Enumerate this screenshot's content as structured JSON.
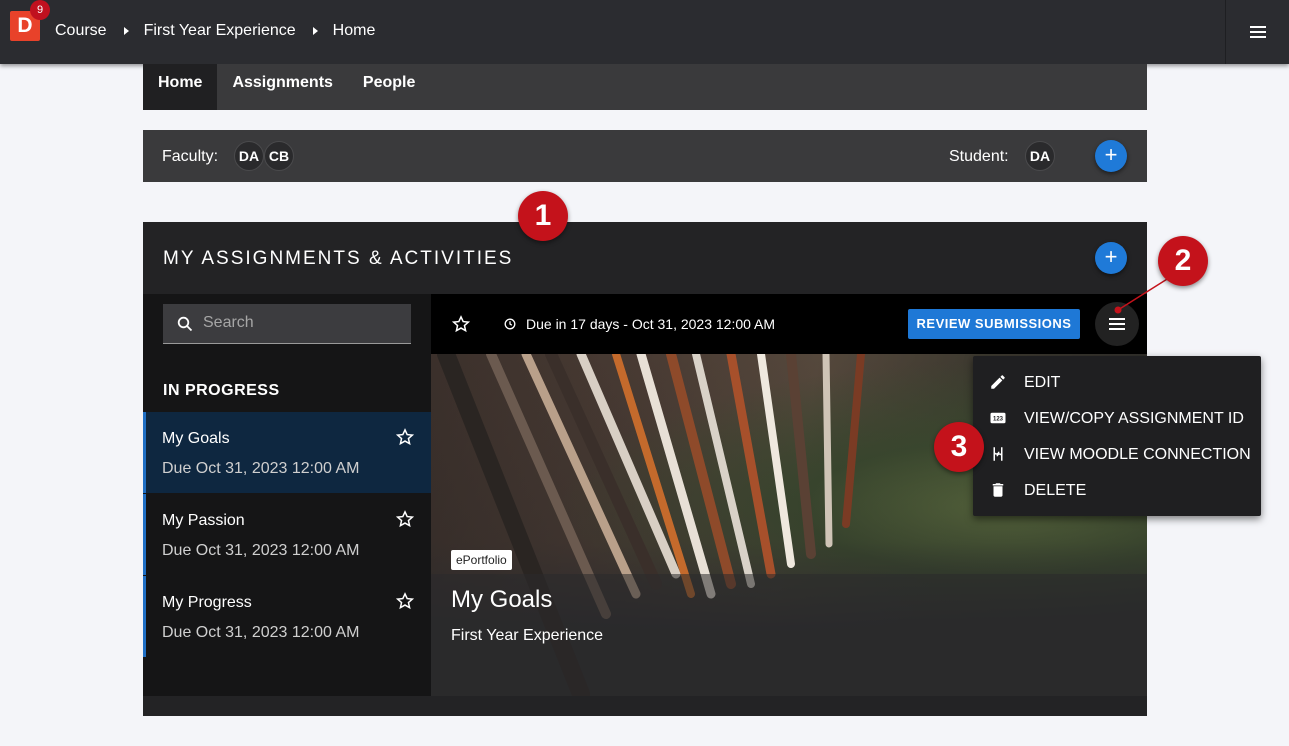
{
  "app": {
    "logo_letter": "D",
    "notification_count": "9"
  },
  "breadcrumbs": [
    "Course",
    "First Year Experience",
    "Home"
  ],
  "tabs": [
    {
      "label": "Home",
      "active": true
    },
    {
      "label": "Assignments",
      "active": false
    },
    {
      "label": "People",
      "active": false
    }
  ],
  "members": {
    "faculty_label": "Faculty:",
    "faculty": [
      "DA",
      "CB"
    ],
    "student_label": "Student:",
    "students": [
      "DA"
    ],
    "add_button": "+"
  },
  "assignments": {
    "title": "MY ASSIGNMENTS & ACTIVITIES",
    "add_button": "+",
    "search_placeholder": "Search",
    "section_label": "IN PROGRESS",
    "items": [
      {
        "title": "My Goals",
        "due": "Due Oct 31, 2023 12:00 AM",
        "selected": true
      },
      {
        "title": "My Passion",
        "due": "Due Oct 31, 2023 12:00 AM",
        "selected": false
      },
      {
        "title": "My Progress",
        "due": "Due Oct 31, 2023 12:00 AM",
        "selected": false
      }
    ]
  },
  "detail": {
    "due_text": "Due in 17 days - Oct 31, 2023 12:00 AM",
    "review_button": "REVIEW SUBMISSIONS",
    "badge": "ePortfolio",
    "title": "My Goals",
    "subtitle": "First Year Experience"
  },
  "menu": {
    "items": [
      {
        "label": "EDIT",
        "icon": "pencil-icon"
      },
      {
        "label": "VIEW/COPY ASSIGNMENT ID",
        "icon": "id-123-icon"
      },
      {
        "label": "VIEW MOODLE CONNECTION",
        "icon": "connection-icon"
      },
      {
        "label": "DELETE",
        "icon": "trash-icon"
      }
    ]
  },
  "callouts": [
    "1",
    "2",
    "3"
  ],
  "colors": {
    "accent_blue": "#1f7ad8",
    "callout_red": "#c4121b",
    "logo_orange": "#e8422a"
  }
}
